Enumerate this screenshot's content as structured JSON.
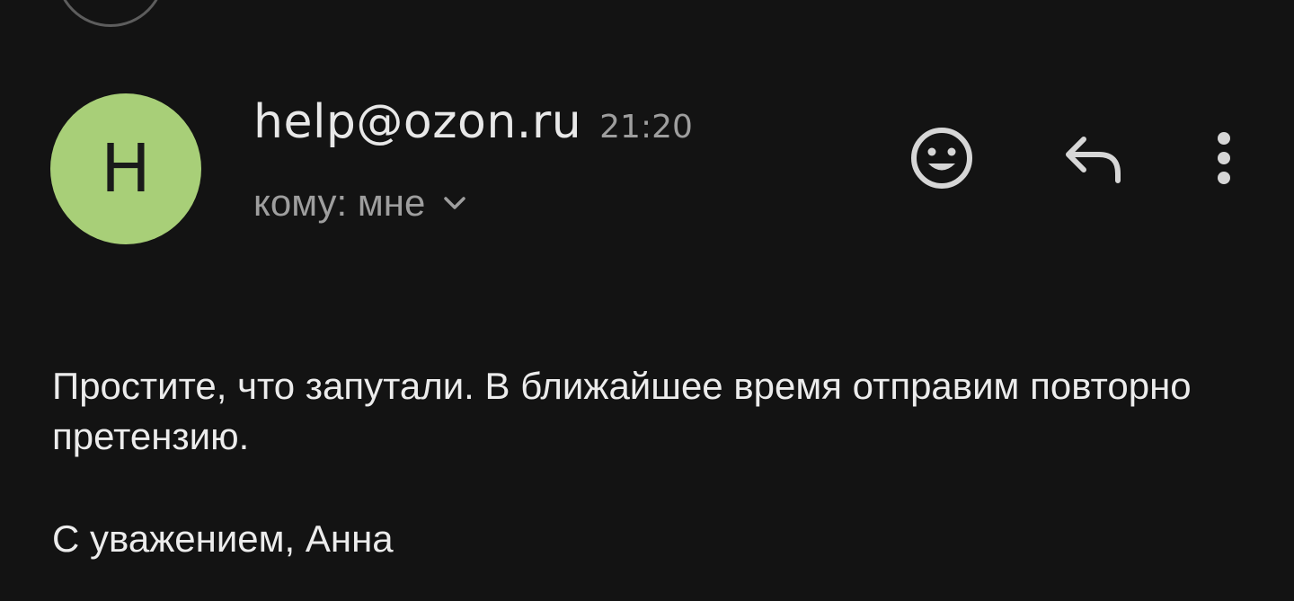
{
  "message": {
    "avatar_letter": "H",
    "sender": "help@ozon.ru",
    "time": "21:20",
    "recipient": "кому: мне",
    "body_paragraph": "Простите, что запутали. В ближайшее время отправим повторно претензию.",
    "signature": "С уважением, Анна"
  },
  "icons": {
    "expand": "chevron-down-icon",
    "emoji": "emoji-reaction-icon",
    "reply": "reply-icon",
    "more": "more-vertical-icon"
  },
  "colors": {
    "background": "#131313",
    "avatar": "#a8cf78",
    "primary_text": "#e8e8e8",
    "secondary_text": "#9e9e9e",
    "icon": "#d6d6d6"
  }
}
